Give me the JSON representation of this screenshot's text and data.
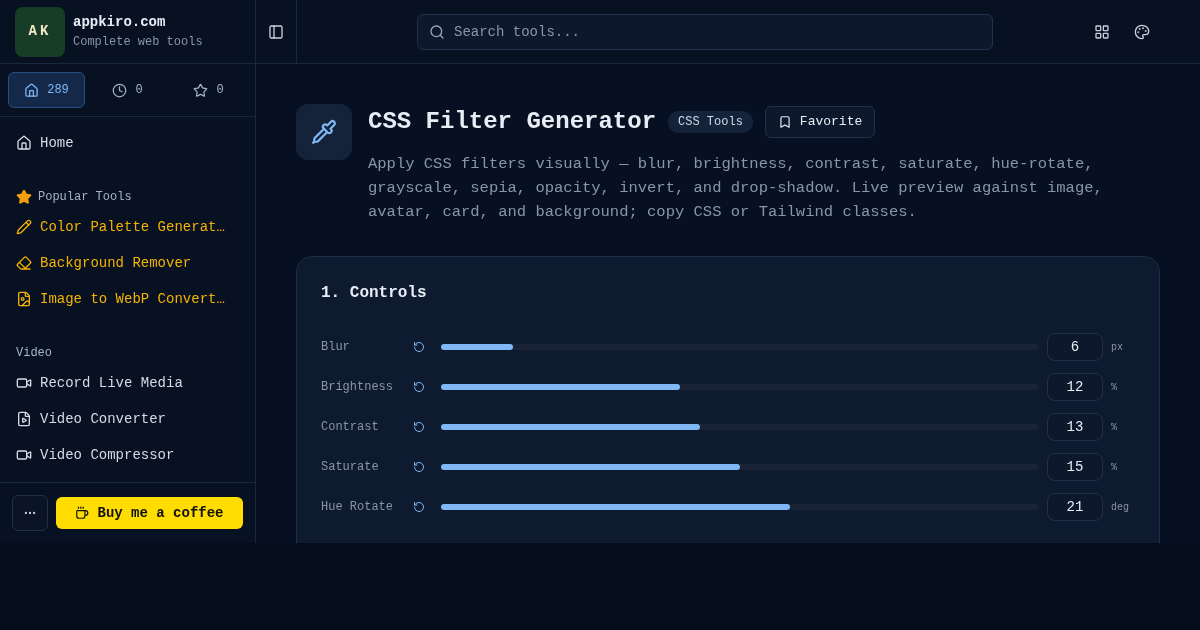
{
  "brand": {
    "logo": "AK",
    "name": "appkiro.com",
    "tagline": "Complete web tools"
  },
  "search": {
    "placeholder": "Search tools..."
  },
  "sidebar_tabs": [
    {
      "count": "289",
      "selected": true
    },
    {
      "count": "0",
      "selected": false
    },
    {
      "count": "0",
      "selected": false
    }
  ],
  "sidebar": {
    "home": "Home",
    "sections": [
      {
        "kind": "popular",
        "title": "Popular Tools",
        "items": [
          "Color Palette Generat…",
          "Background Remover",
          "Image to WebP Convert…"
        ]
      },
      {
        "kind": "category",
        "title": "Video",
        "items": [
          "Record Live Media",
          "Video Converter",
          "Video Compressor"
        ]
      }
    ]
  },
  "coffee_button": "Buy me a coffee",
  "tool": {
    "title": "CSS Filter Generator",
    "tag": "CSS Tools",
    "favorite": "Favorite",
    "description": "Apply CSS filters visually — blur, brightness, contrast, saturate, hue-rotate, grayscale, sepia, opacity, invert, and drop-shadow. Live preview against image, avatar, card, and background; copy CSS or Tailwind classes."
  },
  "controls_card": {
    "title": "1. Controls",
    "controls": [
      {
        "label": "Blur",
        "level": 0.12,
        "value": "6",
        "unit": "px"
      },
      {
        "label": "Brightness",
        "level": 0.4,
        "value": "12",
        "unit": "%"
      },
      {
        "label": "Contrast",
        "level": 0.433,
        "value": "13",
        "unit": "%"
      },
      {
        "label": "Saturate",
        "level": 0.5,
        "value": "15",
        "unit": "%"
      },
      {
        "label": "Hue Rotate",
        "level": 0.584,
        "value": "21",
        "unit": "deg"
      }
    ]
  }
}
